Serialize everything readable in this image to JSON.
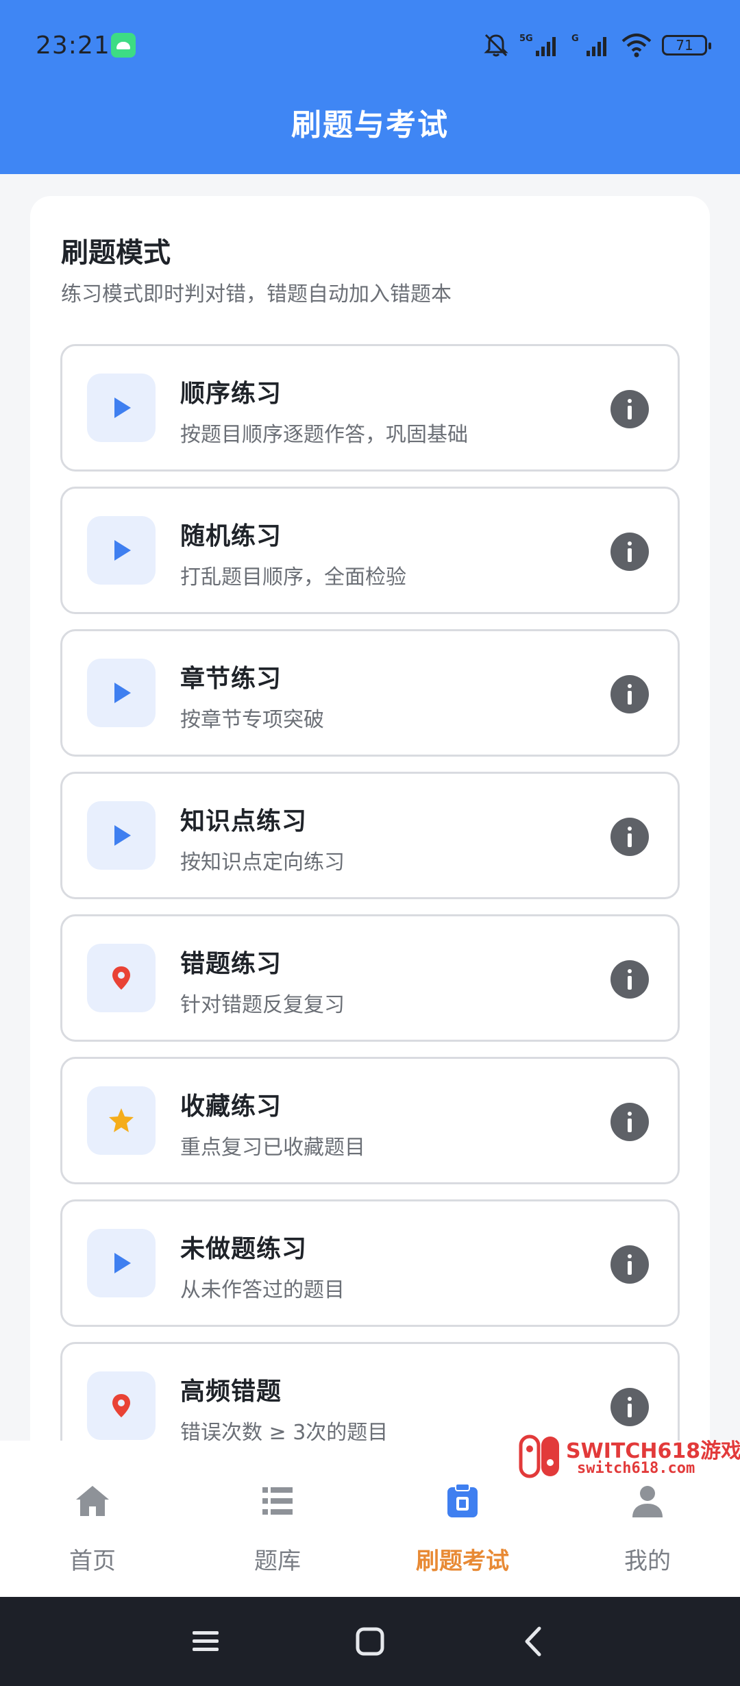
{
  "status_bar": {
    "time": "23:21",
    "battery": "71",
    "network_1": "5G",
    "network_2": "G"
  },
  "header": {
    "title": "刷题与考试"
  },
  "section": {
    "title": "刷题模式",
    "subtitle": "练习模式即时判对错，错题自动加入错题本"
  },
  "modes": [
    {
      "title": "顺序练习",
      "desc": "按题目顺序逐题作答，巩固基础",
      "icon": "play-icon"
    },
    {
      "title": "随机练习",
      "desc": "打乱题目顺序，全面检验",
      "icon": "play-icon"
    },
    {
      "title": "章节练习",
      "desc": "按章节专项突破",
      "icon": "play-icon"
    },
    {
      "title": "知识点练习",
      "desc": "按知识点定向练习",
      "icon": "play-icon"
    },
    {
      "title": "错题练习",
      "desc": "针对错题反复复习",
      "icon": "location-pin-icon"
    },
    {
      "title": "收藏练习",
      "desc": "重点复习已收藏题目",
      "icon": "star-icon"
    },
    {
      "title": "未做题练习",
      "desc": "从未作答过的题目",
      "icon": "play-icon"
    },
    {
      "title": "高频错题",
      "desc": "错误次数 ≥ 3次的题目",
      "icon": "location-pin-icon"
    }
  ],
  "bottom_nav": [
    {
      "label": "首页",
      "icon": "home-icon",
      "active": false
    },
    {
      "label": "题库",
      "icon": "list-icon",
      "active": false
    },
    {
      "label": "刷题考试",
      "icon": "clipboard-icon",
      "active": true
    },
    {
      "label": "我的",
      "icon": "person-icon",
      "active": false
    }
  ],
  "watermark": {
    "line1": "SWITCH618游戏",
    "line2": "switch618.com"
  },
  "colors": {
    "header": "#3f86f4",
    "accent_blue": "#3f7ff0",
    "active_nav": "#e88a35",
    "pin_red": "#e94235",
    "star_yellow": "#f5ad1b"
  }
}
